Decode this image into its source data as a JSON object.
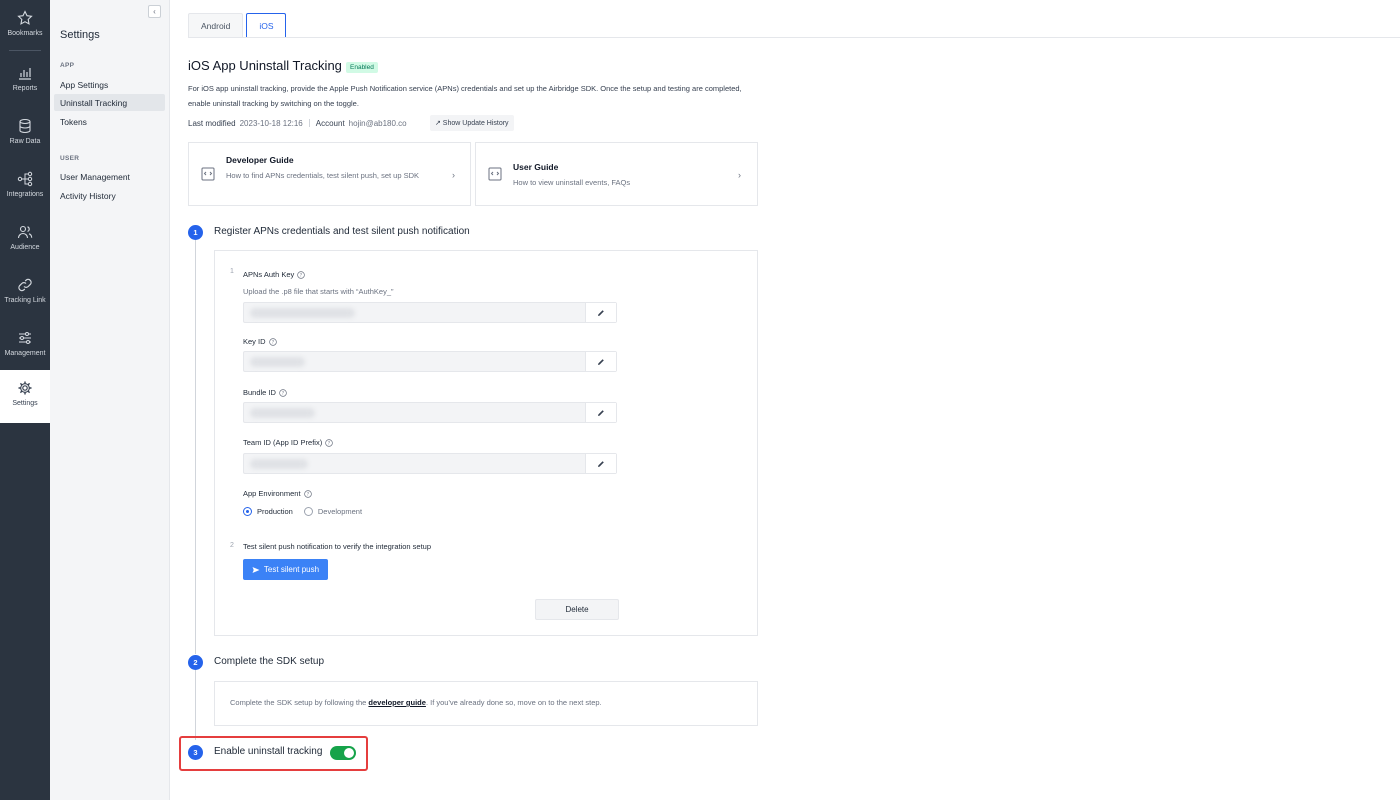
{
  "rail": [
    {
      "label": "Bookmarks",
      "icon": "star-icon"
    },
    {
      "label": "Reports",
      "icon": "bar-chart-icon"
    },
    {
      "label": "Raw Data",
      "icon": "database-icon"
    },
    {
      "label": "Integrations",
      "icon": "integrations-icon"
    },
    {
      "label": "Audience",
      "icon": "users-icon"
    },
    {
      "label": "Tracking Link",
      "icon": "link-icon"
    },
    {
      "label": "Management",
      "icon": "sliders-icon"
    },
    {
      "label": "Settings",
      "icon": "gear-icon"
    }
  ],
  "sidebar": {
    "title": "Settings",
    "sections": [
      {
        "label": "APP",
        "items": [
          "App Settings",
          "Uninstall Tracking",
          "Tokens"
        ]
      },
      {
        "label": "USER",
        "items": [
          "User Management",
          "Activity History"
        ]
      }
    ]
  },
  "tabs": [
    "Android",
    "iOS"
  ],
  "page": {
    "title": "iOS App Uninstall Tracking",
    "status": "Enabled",
    "description": "For iOS app uninstall tracking, provide the Apple Push Notification service (APNs) credentials and set up the Airbridge SDK. Once the setup and testing are completed, enable uninstall tracking by switching on the toggle.",
    "last_modified_label": "Last modified",
    "last_modified_value": "2023-10-18 12:16",
    "account_label": "Account",
    "account_value": "hojin@ab180.co",
    "history_button": "↗ Show Update History"
  },
  "guides": [
    {
      "title": "Developer Guide",
      "desc": "How to find APNs credentials, test silent push, set up SDK"
    },
    {
      "title": "User Guide",
      "desc": "How to view uninstall events, FAQs"
    }
  ],
  "steps": [
    {
      "num": "1",
      "title": "Register APNs credentials and test silent push notification"
    },
    {
      "num": "2",
      "title": "Complete the SDK setup"
    },
    {
      "num": "3",
      "title": "Enable uninstall tracking"
    }
  ],
  "form": {
    "sub1_num": "1",
    "auth_key_label": "APNs Auth Key",
    "auth_key_hint": "Upload the .p8 file that starts with “AuthKey_”",
    "key_id_label": "Key ID",
    "bundle_id_label": "Bundle ID",
    "team_id_label": "Team ID (App ID Prefix)",
    "env_label": "App Environment",
    "env_options": [
      "Production",
      "Development"
    ],
    "env_selected": "Production",
    "sub2_num": "2",
    "test_label": "Test silent push notification to verify the integration setup",
    "test_button": "Test silent push",
    "delete_button": "Delete"
  },
  "sdk": {
    "text_before": "Complete the SDK setup by following the ",
    "link": "developer guide",
    "text_after": ". If you've already done so, move on to the next step."
  },
  "toggle_on": true,
  "colors": {
    "accent": "#2563eb",
    "enabled_badge": "#047857",
    "toggle": "#16a34a",
    "highlight": "#e53e3e"
  }
}
